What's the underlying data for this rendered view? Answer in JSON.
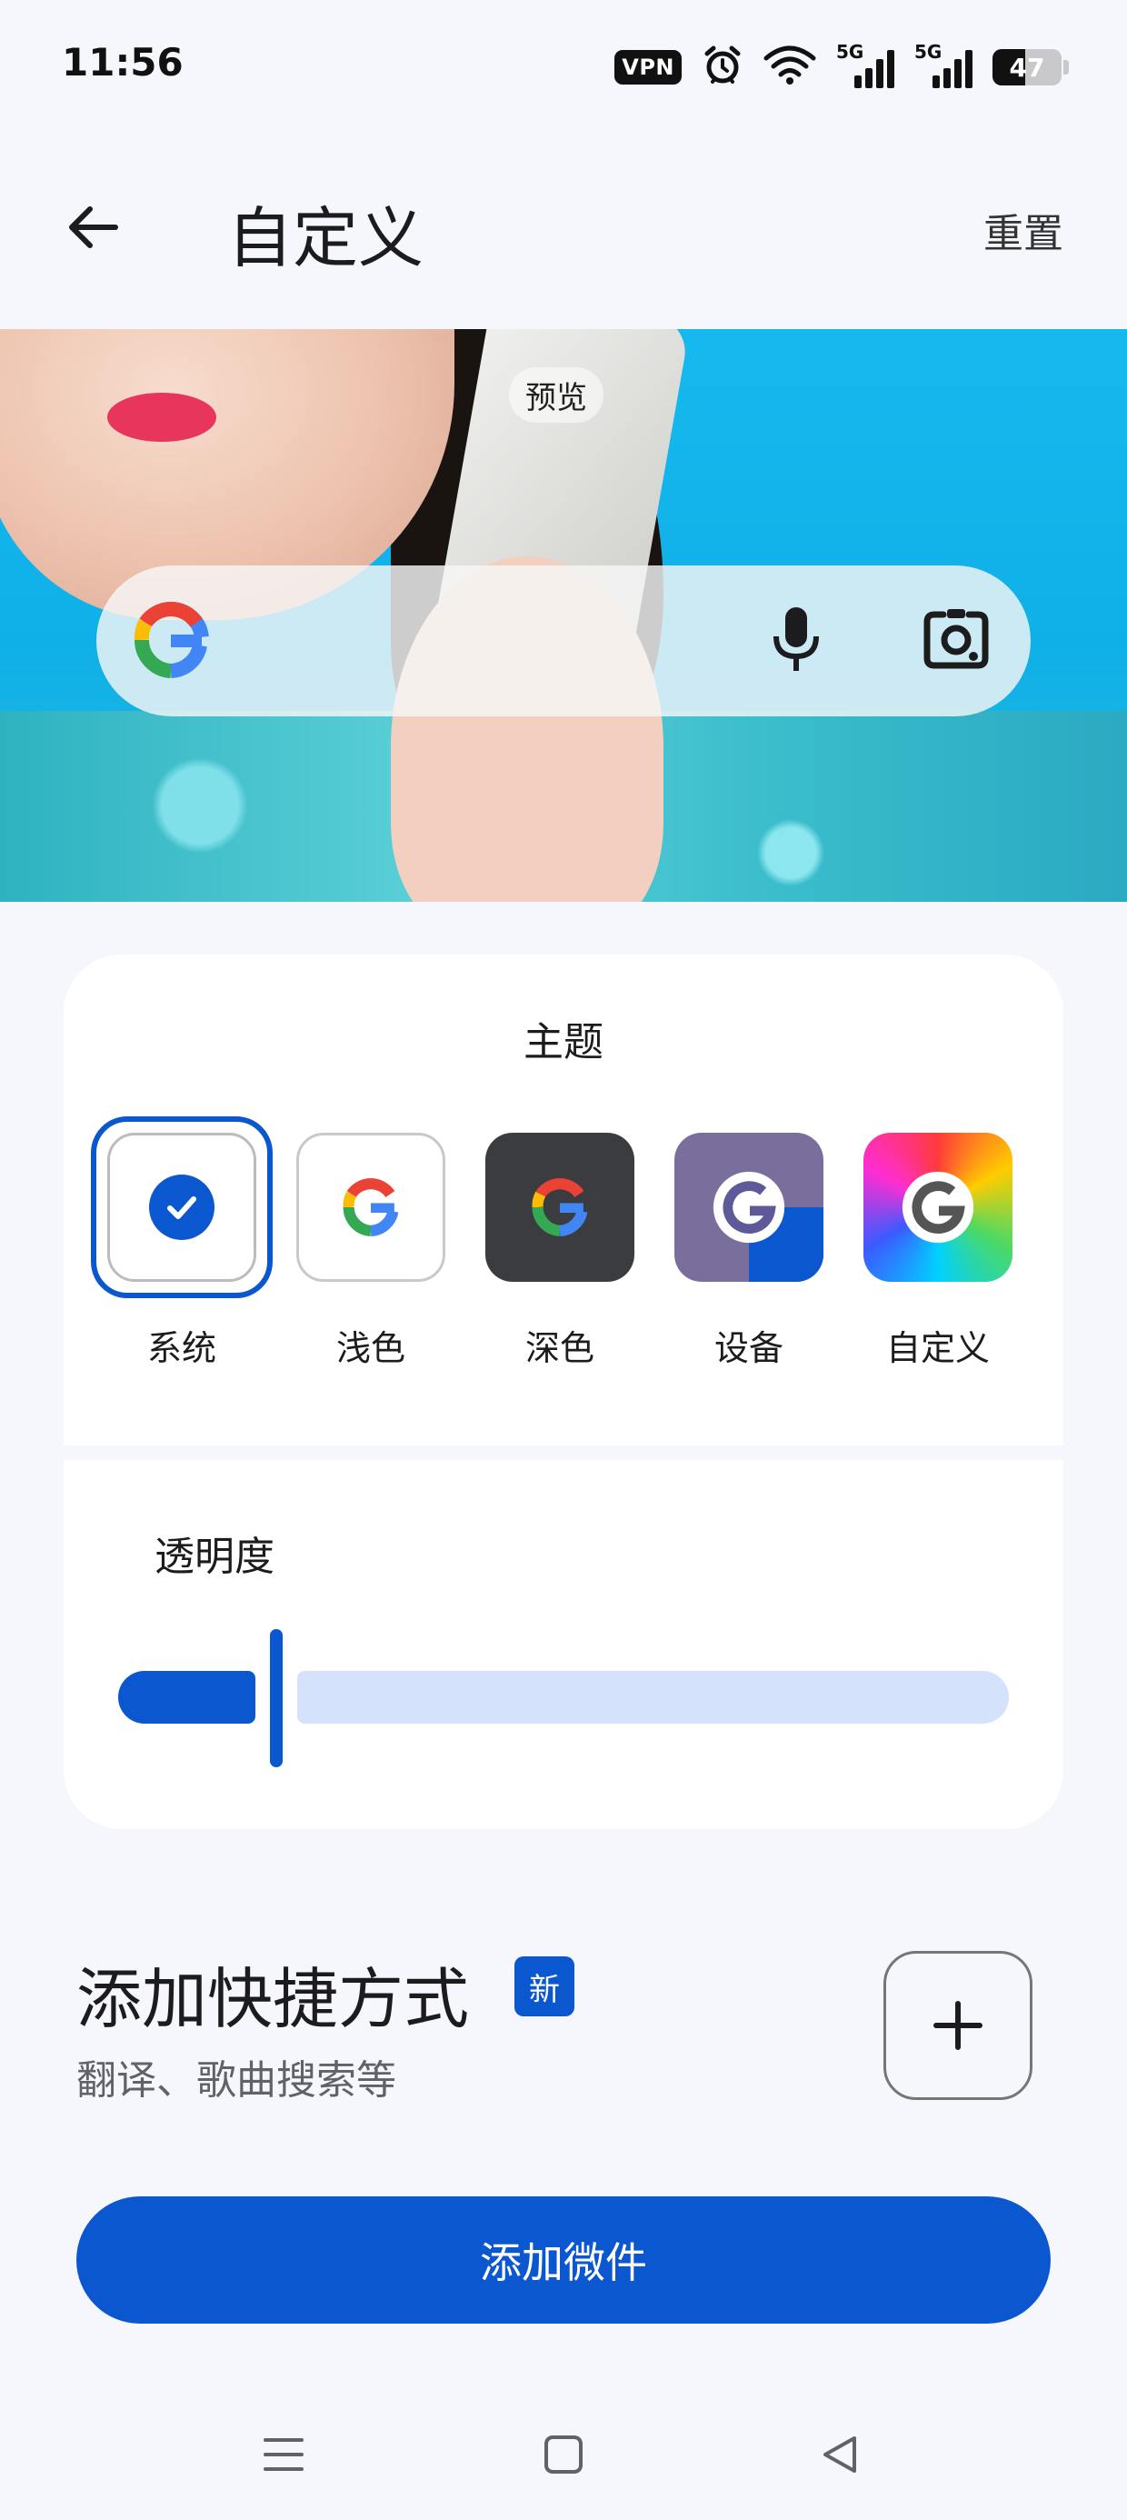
{
  "status_bar": {
    "time": "11:56",
    "vpn_label": "VPN",
    "network_1": "5G",
    "network_2": "5G",
    "battery_percent": "47",
    "battery_level": 0.47,
    "icons": [
      "vpn-icon",
      "alarm-icon",
      "wifi-icon",
      "signal-icon",
      "signal-icon",
      "battery-icon"
    ]
  },
  "app_bar": {
    "title": "自定义",
    "reset_label": "重置",
    "back_icon": "arrow-left-icon"
  },
  "preview": {
    "label": "预览",
    "search_bar_icons": [
      "google-g-icon",
      "mic-icon",
      "google-lens-icon"
    ]
  },
  "theme": {
    "title": "主题",
    "options": [
      {
        "label": "系统",
        "selected": true
      },
      {
        "label": "浅色",
        "selected": false
      },
      {
        "label": "深色",
        "selected": false
      },
      {
        "label": "设备",
        "selected": false
      },
      {
        "label": "自定义",
        "selected": false
      }
    ]
  },
  "opacity": {
    "title": "透明度",
    "value": 0.17
  },
  "shortcut": {
    "title": "添加快捷方式",
    "badge": "新",
    "subtitle": "翻译、歌曲搜索等"
  },
  "add_widget_label": "添加微件",
  "colors": {
    "accent": "#0b57d0",
    "slider_track": "#d4e3fb",
    "background": "#f6f7fc"
  }
}
